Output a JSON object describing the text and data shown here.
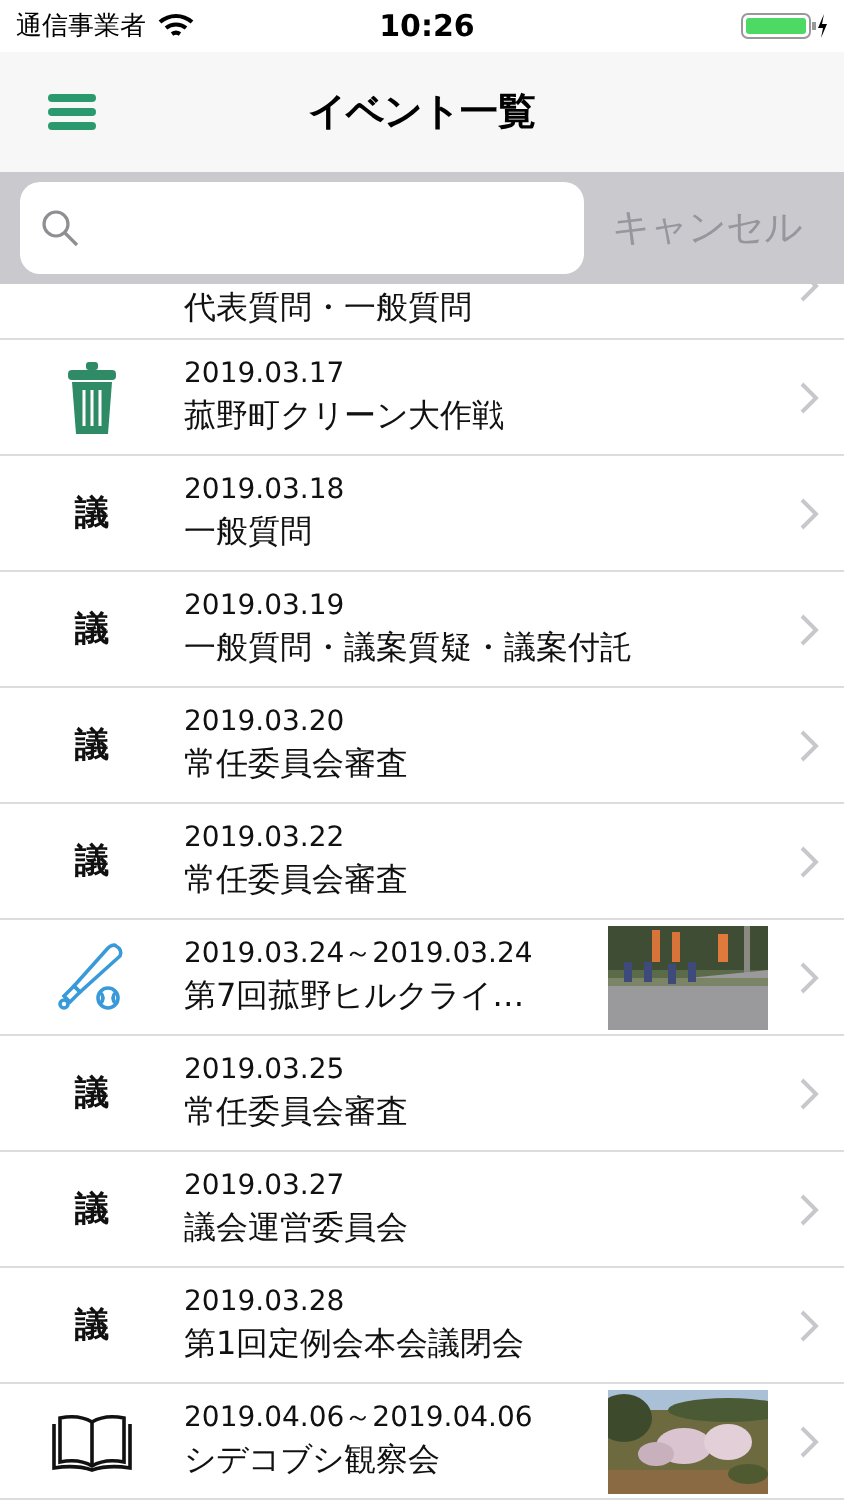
{
  "status_bar": {
    "carrier": "通信事業者",
    "time": "10:26"
  },
  "nav_bar": {
    "title": "イベント一覧"
  },
  "search": {
    "cancel": "キャンセル"
  },
  "events": [
    {
      "kind": "partial",
      "title": "代表質問・一般質問"
    },
    {
      "kind": "trash",
      "date": "2019.03.17",
      "title": "菰野町クリーン大作戦"
    },
    {
      "kind": "text",
      "icon_text": "議",
      "date": "2019.03.18",
      "title": "一般質問"
    },
    {
      "kind": "text",
      "icon_text": "議",
      "date": "2019.03.19",
      "title": "一般質問・議案質疑・議案付託"
    },
    {
      "kind": "text",
      "icon_text": "議",
      "date": "2019.03.20",
      "title": "常任委員会審査"
    },
    {
      "kind": "text",
      "icon_text": "議",
      "date": "2019.03.22",
      "title": "常任委員会審査"
    },
    {
      "kind": "baseball",
      "date": "2019.03.24～2019.03.24",
      "title": "第7回菰野ヒルクライ…",
      "picture": true
    },
    {
      "kind": "text",
      "icon_text": "議",
      "date": "2019.03.25",
      "title": "常任委員会審査"
    },
    {
      "kind": "text",
      "icon_text": "議",
      "date": "2019.03.27",
      "title": "議会運営委員会"
    },
    {
      "kind": "text",
      "icon_text": "議",
      "date": "2019.03.28",
      "title": "第1回定例会本会議閉会"
    },
    {
      "kind": "book",
      "date": "2019.04.06～2019.04.06",
      "title": "シデコブシ観察会",
      "picture": true
    }
  ]
}
